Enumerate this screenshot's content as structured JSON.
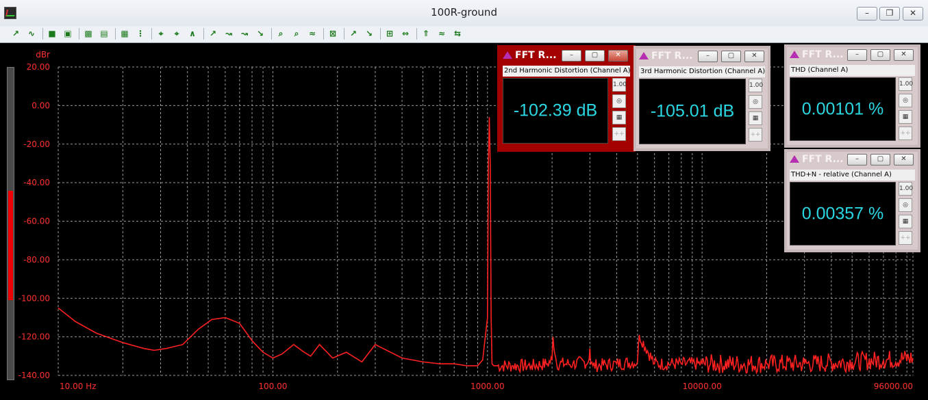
{
  "window": {
    "title": "100R-ground",
    "minimize_glyph": "–",
    "restore_glyph": "❐",
    "close_glyph": "✕"
  },
  "toolbar": {
    "icon_names": [
      "add-trace-icon",
      "wave-icon",
      "save-icon",
      "copy-icon",
      "grid-icon",
      "table-icon",
      "calc-icon",
      "dots-icon",
      "zoom-x-icon",
      "zoom-y-icon",
      "scale-icon",
      "cursor-icon",
      "cursor2-icon",
      "cursor3-icon",
      "cursor4-icon",
      "find-icon",
      "find2-icon",
      "marker-icon",
      "autoscale-icon",
      "peak-icon",
      "peak2-icon",
      "grid2-icon",
      "arrows-icon",
      "gray-icon",
      "red-icon",
      "flip-icon"
    ]
  },
  "graph": {
    "y_unit": "dBr",
    "x_ticks": [
      "10.00 Hz",
      "100.00",
      "1000.00",
      "10000.00",
      "96000.00"
    ],
    "y_ticks": [
      "20.00",
      "0.00",
      "-20.00",
      "-40.00",
      "-60.00",
      "-80.00",
      "-100.00",
      "-120.00",
      "-140.00"
    ],
    "colors": {
      "grid": "#9a9a9a",
      "trace": "#ff2020",
      "axis_text": "#ff3030"
    }
  },
  "chart_data": {
    "type": "line",
    "x_scale": "log",
    "xlim": [
      10,
      96000
    ],
    "ylim": [
      -140,
      20
    ],
    "ylabel": "dBr",
    "grid": true,
    "series": [
      {
        "x": [
          10,
          12,
          15,
          20,
          25,
          28,
          32,
          38,
          45,
          52,
          60,
          70,
          80,
          90,
          100,
          110,
          125,
          140,
          150,
          165,
          190,
          220,
          260,
          300,
          400,
          500,
          600,
          700,
          800,
          900,
          950,
          1000,
          1010,
          1020,
          1030,
          1040,
          1050,
          1070,
          1100,
          1300,
          1600,
          1900,
          2000,
          2020,
          2100,
          2500,
          2950,
          3000,
          3030,
          3100,
          4000,
          5000,
          5100,
          6000,
          8000,
          10000,
          20000,
          30000,
          50000,
          70000,
          96000
        ],
        "y": [
          -105,
          -112,
          -118,
          -123,
          -126,
          -127,
          -126,
          -124,
          -116,
          -111,
          -110,
          -113,
          -122,
          -128,
          -131,
          -129,
          -124,
          -128,
          -130,
          -124,
          -131,
          -128,
          -133,
          -124,
          -131,
          -133,
          -134,
          -134,
          -135,
          -135,
          -132,
          -110,
          -30,
          -6,
          -30,
          -110,
          -134,
          -135,
          -135,
          -135,
          -135,
          -134,
          -132,
          -120,
          -134,
          -134,
          -133,
          -126,
          -134,
          -135,
          -134,
          -133,
          -119,
          -134,
          -134,
          -134,
          -134,
          -134,
          -133,
          -132,
          -131
        ]
      }
    ]
  },
  "panels": [
    {
      "title": "FFT R...",
      "caption": "2nd Harmonic Distortion (Channel A)",
      "value": "-102.39 dB",
      "side_labels": [
        "1.00",
        "◎",
        "▦",
        "++"
      ]
    },
    {
      "title": "FFT R...",
      "caption": "3rd Harmonic Distortion (Channel A)",
      "value": "-105.01 dB",
      "side_labels": [
        "1.00",
        "◎",
        "▦",
        "++"
      ]
    },
    {
      "title": "FFT R...",
      "caption": "THD (Channel A)",
      "value": "0.00101 %",
      "side_labels": [
        "1.00",
        "◎",
        "▦",
        "++"
      ]
    },
    {
      "title": "FFT R...",
      "caption": "THD+N - relative (Channel A)",
      "value": "0.00357 %",
      "side_labels": [
        "1.00",
        "◎",
        "▦",
        "++"
      ]
    }
  ],
  "panel_buttons": {
    "minimize": "–",
    "maximize": "▢",
    "close": "✕"
  },
  "meter_level_percent": 35
}
